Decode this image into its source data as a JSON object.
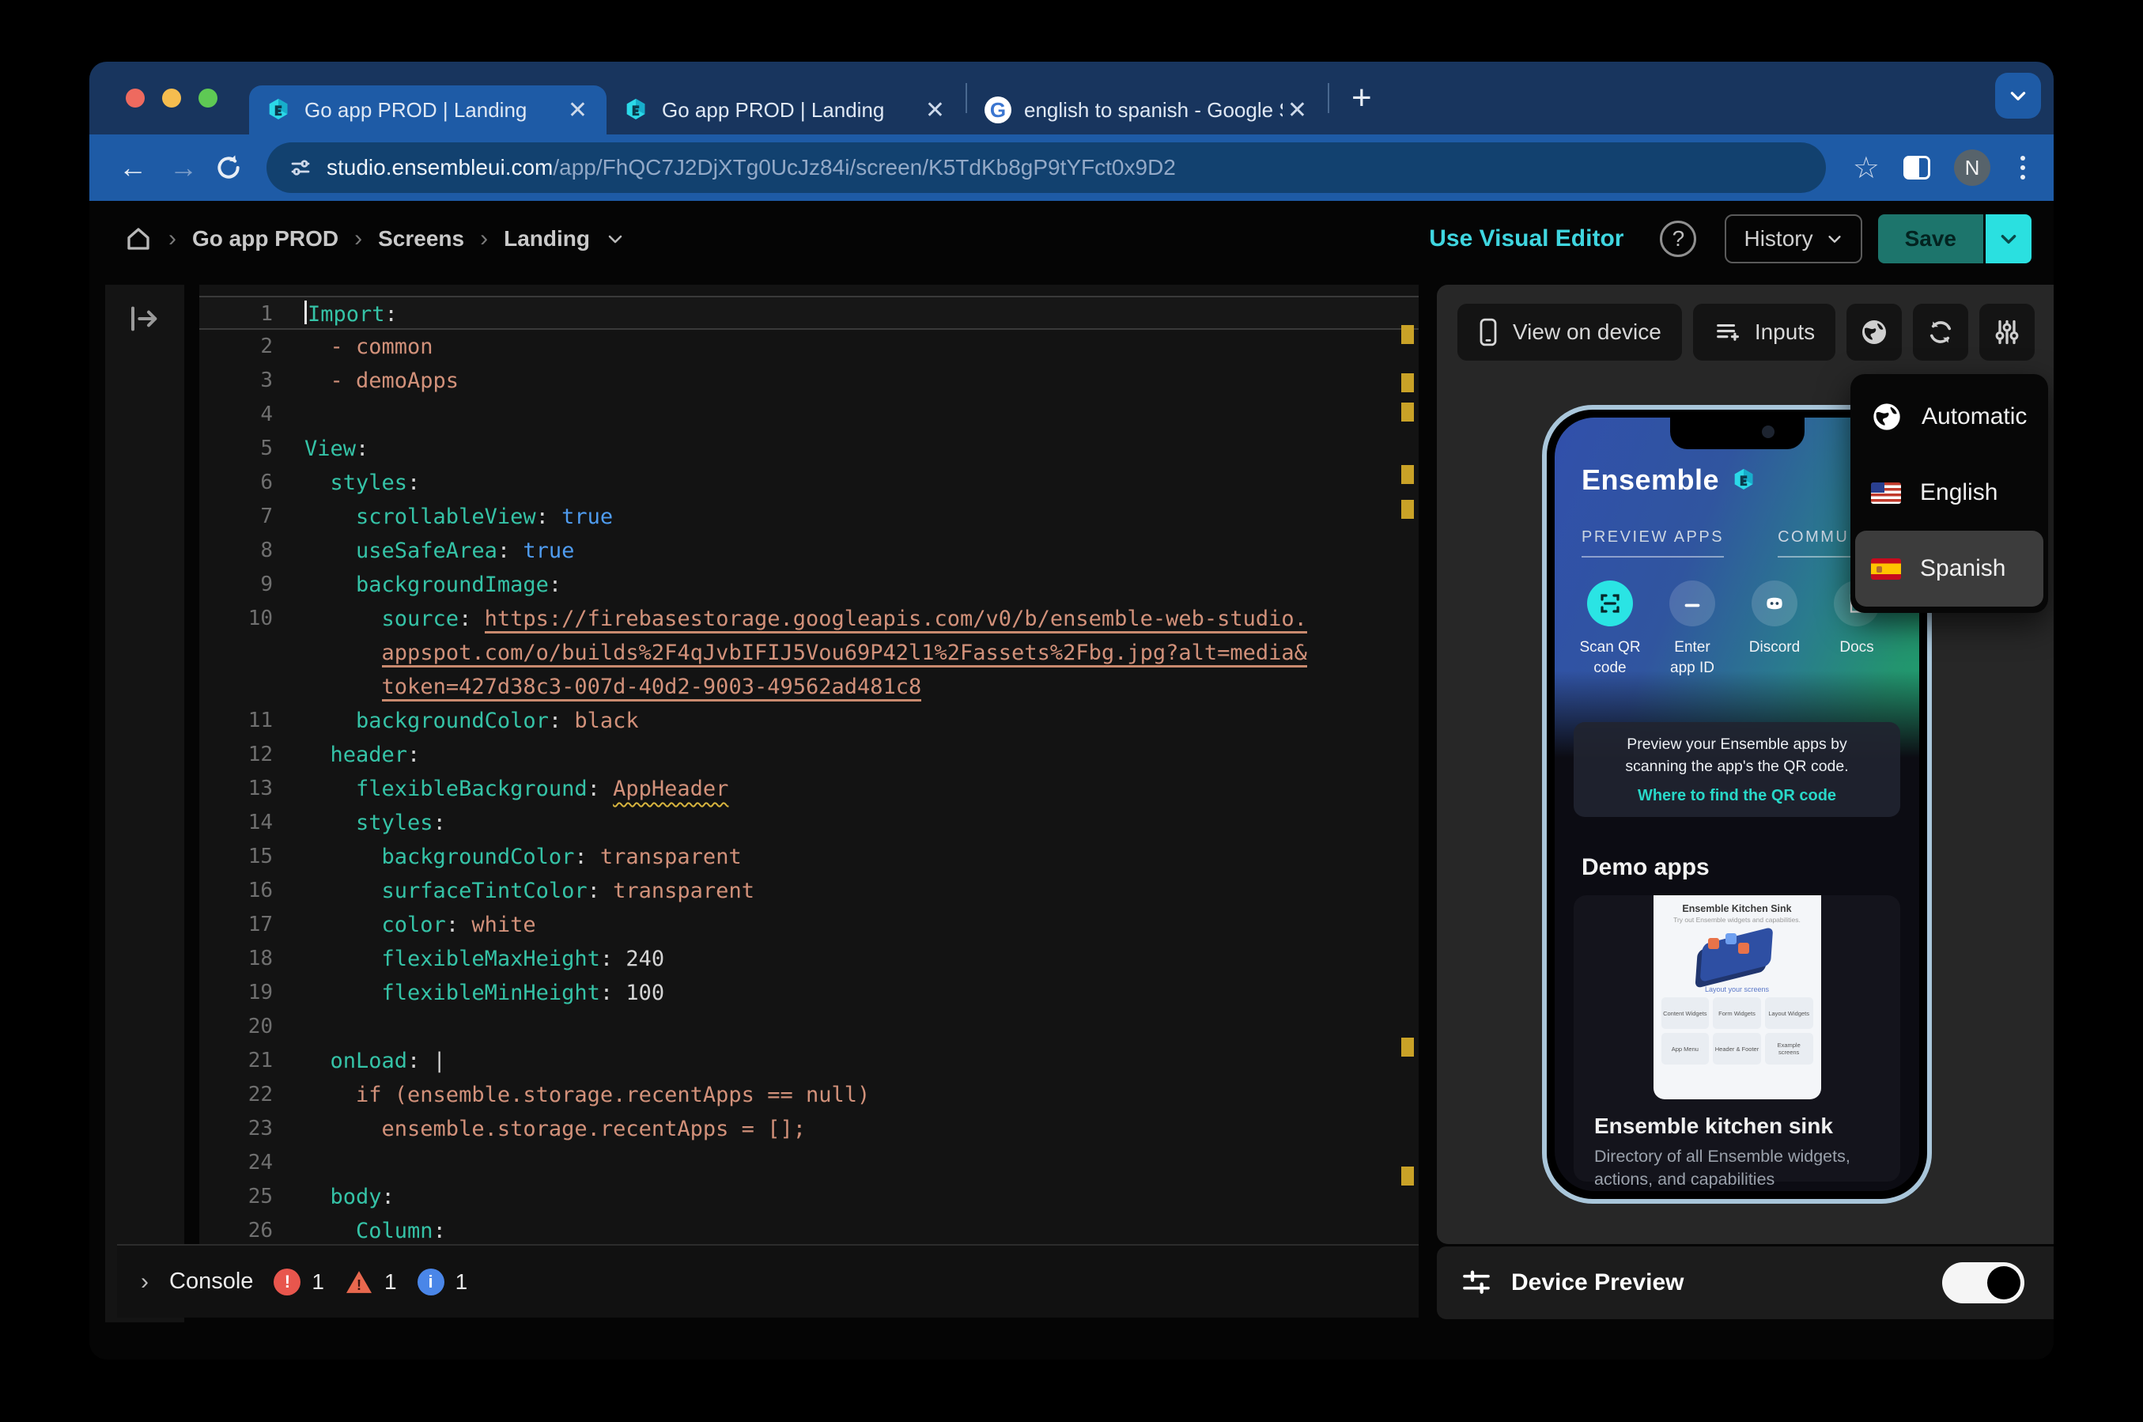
{
  "browser": {
    "tabs": [
      {
        "title": "Go app PROD | Landing"
      },
      {
        "title": "Go app PROD | Landing"
      },
      {
        "title": "english to spanish - Google S"
      }
    ],
    "close_glyph": "✕",
    "new_tab_glyph": "+",
    "google_glyph": "G",
    "url_host": "studio.ensembleui.com",
    "url_path": "/app/FhQC7J2DjXTg0UcJz84i/screen/K5TdKb8gP9tYFct0x9D2",
    "back_glyph": "←",
    "forward_glyph": "→",
    "star_glyph": "☆",
    "avatar": "N"
  },
  "header": {
    "crumb1": "Go app PROD",
    "crumb2": "Screens",
    "crumb3": "Landing",
    "sep": "›",
    "visual_editor": "Use Visual Editor",
    "help": "?",
    "history": "History",
    "save": "Save"
  },
  "editor": {
    "rows": [
      {
        "n": "1",
        "k": "Import",
        "p": ":",
        "cur": true,
        "caret": true
      },
      {
        "n": "2",
        "v": "  - common"
      },
      {
        "n": "3",
        "v": "  - demoApps"
      },
      {
        "n": "4"
      },
      {
        "n": "5",
        "k": "View",
        "p": ":"
      },
      {
        "n": "6",
        "k": "  styles",
        "p": ":"
      },
      {
        "n": "7",
        "k": "    scrollableView",
        "p": ": ",
        "b": "true"
      },
      {
        "n": "8",
        "k": "    useSafeArea",
        "p": ": ",
        "b": "true"
      },
      {
        "n": "9",
        "k": "    backgroundImage",
        "p": ":"
      },
      {
        "n": "10",
        "k": "      source",
        "p": ": ",
        "u": "https://firebasestorage.googleapis.com/v0/b/ensemble-web-studio."
      },
      {
        "n": "",
        "i": "      ",
        "u": "appspot.com/o/builds%2F4qJvbIFIJ5Vou69P42l1%2Fassets%2Fbg.jpg?alt=media&"
      },
      {
        "n": "",
        "i": "      ",
        "u": "token=427d38c3-007d-40d2-9003-49562ad481c8"
      },
      {
        "n": "11",
        "k": "    backgroundColor",
        "p": ": ",
        "v": "black"
      },
      {
        "n": "12",
        "k": "  header",
        "p": ":"
      },
      {
        "n": "13",
        "k": "    flexibleBackground",
        "p": ": ",
        "w": "AppHeader"
      },
      {
        "n": "14",
        "k": "    styles",
        "p": ":"
      },
      {
        "n": "15",
        "k": "      backgroundColor",
        "p": ": ",
        "v": "transparent"
      },
      {
        "n": "16",
        "k": "      surfaceTintColor",
        "p": ": ",
        "v": "transparent"
      },
      {
        "n": "17",
        "k": "      color",
        "p": ": ",
        "v": "white"
      },
      {
        "n": "18",
        "k": "      flexibleMaxHeight",
        "p": ": ",
        "num": "240"
      },
      {
        "n": "19",
        "k": "      flexibleMinHeight",
        "p": ": ",
        "num": "100"
      },
      {
        "n": "20"
      },
      {
        "n": "21",
        "k": "  onLoad",
        "p": ": |"
      },
      {
        "n": "22",
        "v": "    if (ensemble.storage.recentApps == null)"
      },
      {
        "n": "23",
        "v": "      ensemble.storage.recentApps = [];"
      },
      {
        "n": "24"
      },
      {
        "n": "25",
        "k": "  body",
        "p": ":"
      },
      {
        "n": "26",
        "k": "    Column",
        "p": ":"
      }
    ]
  },
  "console": {
    "chevron": "›",
    "label": "Console",
    "error_glyph": "!",
    "error_count": "1",
    "warn_count": "1",
    "info_glyph": "i",
    "info_count": "1"
  },
  "panel": {
    "view_on_device": "View on device",
    "inputs": "Inputs",
    "device_preview": "Device Preview"
  },
  "dropdown": {
    "item1": "Automatic",
    "item2": "English",
    "item3": "Spanish"
  },
  "phone": {
    "brand": "Ensemble",
    "tab_preview": "PREVIEW APPS",
    "tab_community": "COMMUNITY &",
    "action1a": "Scan QR",
    "action1b": "code",
    "action2a": "Enter",
    "action2b": "app ID",
    "action3": "Discord",
    "action4": "Docs",
    "card_text": "Preview your Ensemble apps by scanning the app's the QR code.",
    "card_link": "Where to find the QR code",
    "demo_heading": "Demo apps",
    "kitchen_title": "Ensemble Kitchen Sink",
    "kitchen_sub": "Try out Ensemble widgets and capabilities.",
    "layout_label": "Layout your screens",
    "tile1": "Content Widgets",
    "tile2": "Form Widgets",
    "tile3": "Layout Widgets",
    "tile4": "App Menu",
    "tile5": "Header & Footer",
    "tile6": "Example screens",
    "app_name": "Ensemble kitchen sink",
    "app_desc": "Directory of all Ensemble widgets, actions, and capabilities"
  },
  "colors": {
    "accent_cyan": "#3fd6e0",
    "save_teal": "#1d756c",
    "save_chevron_cyan": "#2ae0e0",
    "key_teal": "#35c3a7",
    "value_salmon": "#d2917a",
    "bool_blue": "#4f9cf0",
    "marker_yellow": "#c9a227",
    "error_red": "#e8564d",
    "warn_orange": "#e8684e",
    "info_blue": "#4a86e8"
  }
}
